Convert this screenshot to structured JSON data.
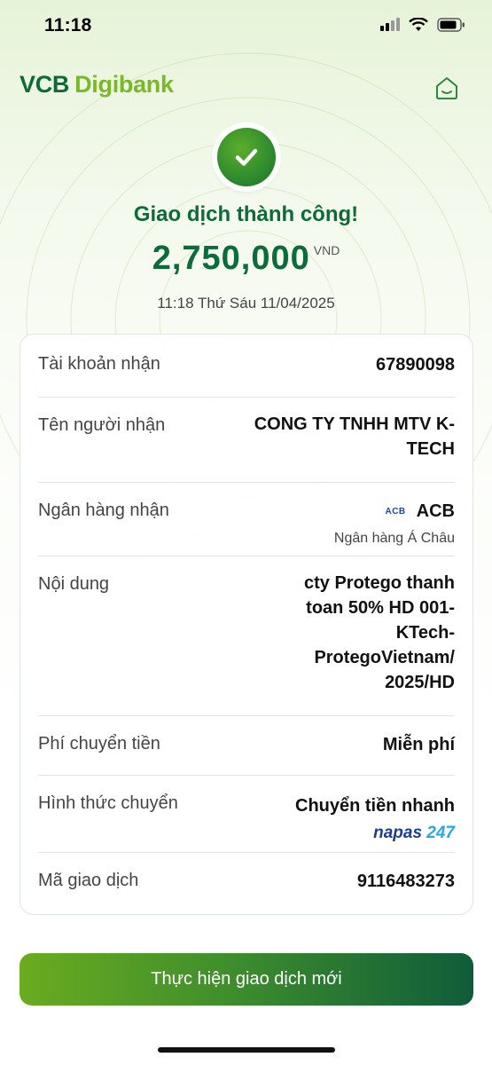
{
  "status_bar": {
    "time": "11:18"
  },
  "header": {
    "logo_vcb": "VCB",
    "logo_digibank": "Digibank"
  },
  "result": {
    "title": "Giao dịch thành công!",
    "amount": "2,750,000",
    "currency": "VND",
    "datetime": "11:18 Thứ Sáu 11/04/2025"
  },
  "details": {
    "account_label": "Tài khoản nhận",
    "account_value": "67890098",
    "recipient_label": "Tên người nhận",
    "recipient_value_line1": "CONG TY TNHH MTV K-",
    "recipient_value_line2": "TECH",
    "bank_label": "Ngân hàng nhận",
    "bank_logo_text": "ACB",
    "bank_value": "ACB",
    "bank_fullname": "Ngân hàng Á Châu",
    "content_label": "Nội dung",
    "content_lines": [
      "cty Protego thanh",
      "toan 50% HD 001-",
      "KTech-",
      "ProtegoVietnam/",
      "2025/HD"
    ],
    "fee_label": "Phí chuyển tiền",
    "fee_value": "Miễn phí",
    "method_label": "Hình thức chuyển",
    "method_value": "Chuyển tiền nhanh",
    "method_brand_a": "napas",
    "method_brand_b": "247",
    "txid_label": "Mã giao dịch",
    "txid_value": "9116483273"
  },
  "actions": {
    "new_transaction_label": "Thực hiện giao dịch mới"
  },
  "icons": {
    "signal": "signal-icon",
    "wifi": "wifi-icon",
    "battery": "battery-icon",
    "home": "home-icon",
    "success": "checkmark-icon"
  },
  "colors": {
    "brand_green": "#0c6b3b",
    "brand_lime": "#7ab828"
  }
}
